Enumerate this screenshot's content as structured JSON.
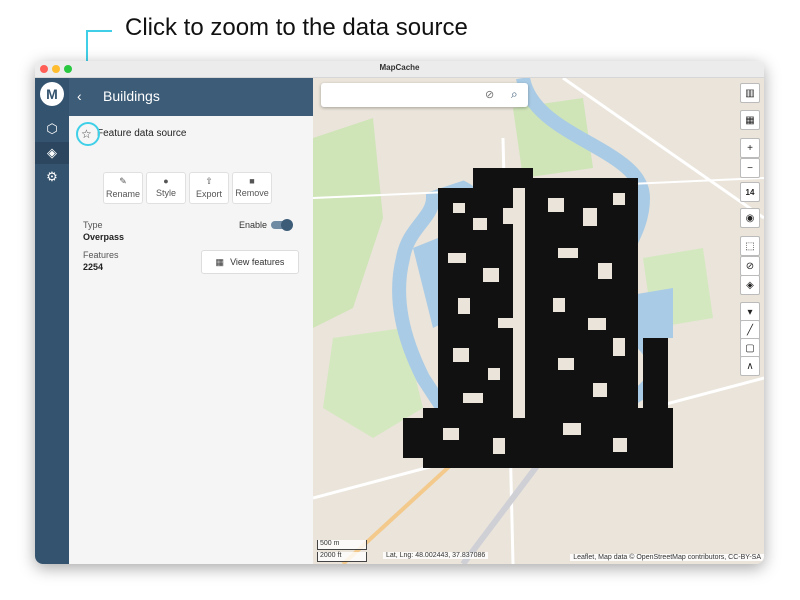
{
  "callout": {
    "text": "Click to zoom to the data source",
    "color": "#3fd0e8"
  },
  "window": {
    "title": "MapCache"
  },
  "panel": {
    "title": "Buildings",
    "data_source_label": "Feature data source",
    "actions": [
      {
        "label": "Rename",
        "icon": "pencil-icon"
      },
      {
        "label": "Style",
        "icon": "palette-icon"
      },
      {
        "label": "Export",
        "icon": "export-icon"
      },
      {
        "label": "Remove",
        "icon": "trash-icon"
      }
    ],
    "type_label": "Type",
    "type_value": "Overpass",
    "features_label": "Features",
    "features_value": "2254",
    "enable_label": "Enable",
    "enabled": true,
    "view_features_label": "View features"
  },
  "map": {
    "zoom_level": "14",
    "scale_metric": "500 m",
    "scale_imperial": "2000 ft",
    "latlng": "Lat, Lng: 48.002443, 37.837086",
    "attribution": "Leaflet, Map data © OpenStreetMap contributors, CC-BY-SA"
  },
  "colors": {
    "rail": "#34536e",
    "header": "#3c5c78",
    "accent": "#3fd0e8"
  }
}
